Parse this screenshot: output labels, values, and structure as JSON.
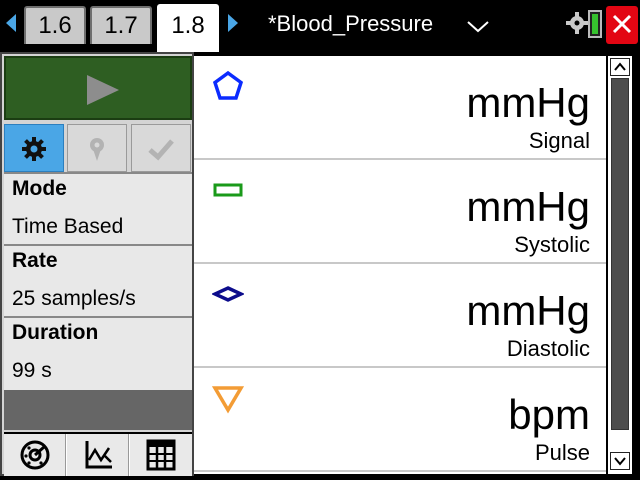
{
  "topbar": {
    "tabs": [
      {
        "label": "1.6",
        "active": false
      },
      {
        "label": "1.7",
        "active": false
      },
      {
        "label": "1.8",
        "active": true
      }
    ],
    "document_title": "*Blood_Pressure",
    "battery_color": "#36c22e",
    "close_color": "#e30613"
  },
  "left_panel": {
    "play_icon": "play-icon",
    "mode_buttons": [
      {
        "icon": "gear-icon",
        "active": true
      },
      {
        "icon": "pin-icon",
        "active": false
      },
      {
        "icon": "checkmark-icon",
        "active": false
      }
    ],
    "settings": [
      {
        "label": "Mode",
        "value": "Time Based"
      },
      {
        "label": "Rate",
        "value": "25 samples/s"
      },
      {
        "label": "Duration",
        "value": "99 s"
      }
    ],
    "view_buttons": [
      {
        "icon": "meter-view-icon"
      },
      {
        "icon": "graph-view-icon"
      },
      {
        "icon": "table-view-icon"
      }
    ]
  },
  "meters": [
    {
      "unit": "mmHg",
      "name": "Signal",
      "icon": "pentagon-icon",
      "color": "#0b2bff"
    },
    {
      "unit": "mmHg",
      "name": "Systolic",
      "icon": "rectangle-icon",
      "color": "#1a9a1a"
    },
    {
      "unit": "mmHg",
      "name": "Diastolic",
      "icon": "diamond-icon",
      "color": "#0c0c8c"
    },
    {
      "unit": "bpm",
      "name": "Pulse",
      "icon": "triangle-icon",
      "color": "#f39c35"
    }
  ]
}
